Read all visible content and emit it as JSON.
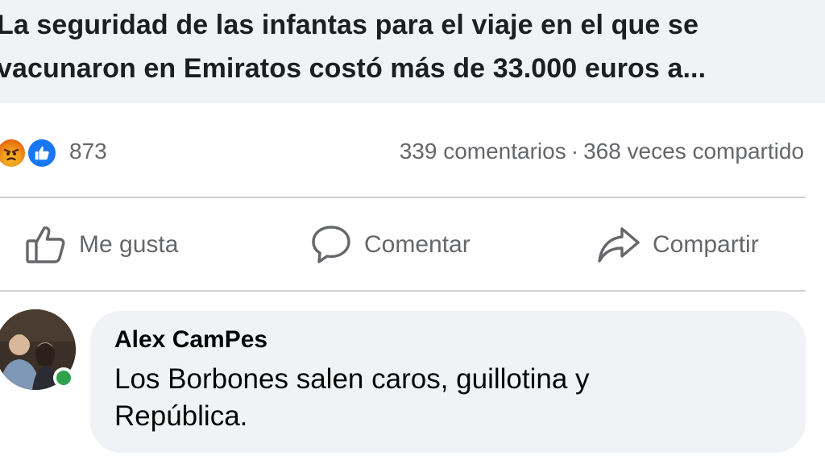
{
  "post": {
    "headline": "La seguridad de las infantas para el viaje en el que se vacunaron en Emiratos costó más de 33.000 euros a..."
  },
  "stats": {
    "reactions": [
      "angry",
      "like"
    ],
    "reaction_count": "873",
    "comments": "339 comentarios",
    "separator": "·",
    "shares": "368 veces compartido"
  },
  "actions": {
    "like_label": "Me gusta",
    "comment_label": "Comentar",
    "share_label": "Compartir"
  },
  "comment": {
    "author": "Alex CamPes",
    "text": "Los Borbones salen caros, guillotina y República.",
    "online": true
  },
  "colors": {
    "like_blue": "#1877f2",
    "angry_orange": "#e9710f",
    "online_green": "#31a24c",
    "muted_text": "#65676b",
    "bubble_bg": "#f0f2f5"
  }
}
